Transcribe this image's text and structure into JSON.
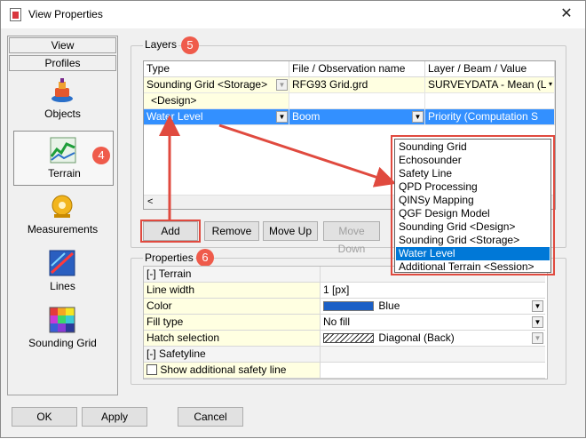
{
  "window": {
    "title": "View Properties",
    "close": "✕"
  },
  "nav": {
    "tabs": [
      "View",
      "Profiles"
    ],
    "items": [
      {
        "label": "Objects",
        "icon": "objects-icon"
      },
      {
        "label": "Terrain",
        "icon": "terrain-icon"
      },
      {
        "label": "Measurements",
        "icon": "measurements-icon"
      },
      {
        "label": "Lines",
        "icon": "lines-icon"
      },
      {
        "label": "Sounding Grid",
        "icon": "sounding-grid-icon"
      }
    ]
  },
  "badges": {
    "terrain": "4",
    "layers": "5",
    "properties": "6"
  },
  "layers": {
    "title": "Layers",
    "columns": [
      "Type",
      "File / Observation name",
      "Layer / Beam / Value"
    ],
    "rows": [
      {
        "type": "Sounding Grid <Storage>",
        "file": "RFG93 Grid.grd",
        "value": "SURVEYDATA - Mean (L"
      },
      {
        "type": "<Design>",
        "file": "",
        "value": ""
      },
      {
        "type": "Water Level",
        "file": "Boom",
        "value": "Priority (Computation S"
      }
    ],
    "scroll_left": "<",
    "buttons": {
      "add": "Add",
      "remove": "Remove",
      "move_up": "Move Up",
      "move_down": "Move Down"
    }
  },
  "type_dropdown": {
    "options": [
      "Sounding Grid",
      "Echosounder",
      "Safety Line",
      "QPD Processing",
      "QINSy Mapping",
      "QGF Design Model",
      "Sounding Grid <Design>",
      "Sounding Grid <Storage>",
      "Water Level",
      "Additional Terrain <Session>"
    ],
    "selected": "Water Level"
  },
  "properties": {
    "title": "Properties",
    "terrain_category": "[-] Terrain",
    "line_width_label": "Line width",
    "line_width_value": "1 [px]",
    "color_label": "Color",
    "color_value": "Blue",
    "color_swatch": "#1b5fc6",
    "fill_type_label": "Fill type",
    "fill_type_value": "No fill",
    "hatch_label": "Hatch selection",
    "hatch_value": "Diagonal (Back)",
    "safetyline_category": "[-] Safetyline",
    "show_safety_label": "Show additional safety line"
  },
  "footer": {
    "ok": "OK",
    "apply": "Apply",
    "cancel": "Cancel"
  },
  "colors": {
    "highlight": "#0078d7",
    "annotation": "#e04a3f",
    "row_selected": "#3390ff"
  }
}
